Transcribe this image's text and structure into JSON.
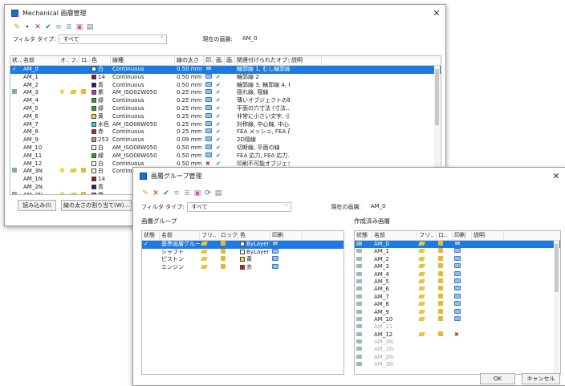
{
  "win1": {
    "title": "Mechanical 画層管理",
    "filter_label": "フィルタ タイプ:",
    "filter_value": "すべて",
    "current_label": "現在の画層:",
    "current_value": "AM_0",
    "columns": [
      "状..",
      "名前",
      "オ..",
      "フ..",
      "ロ..",
      "色",
      "線種",
      "線の太さ",
      "印..",
      "画..",
      "画..",
      "関連付けられたオブジ...",
      "説明"
    ],
    "rows": [
      {
        "st": "✓",
        "name": "AM_0",
        "on": "",
        "fr": "",
        "lk": "",
        "ccol": "#ffffff",
        "cname": "白",
        "lt": "Continuous",
        "lw": "0.50 mm",
        "pl": "1",
        "a": "1",
        "b": "1",
        "rel": "輪郭線 1, むし輪郭線",
        "sel": true
      },
      {
        "st": "",
        "name": "AM_1",
        "on": "",
        "fr": "",
        "lk": "",
        "ccol": "#8b1a1a",
        "cname": "14",
        "lt": "Continuous",
        "lw": "0.50 mm",
        "pl": "1",
        "a": "1",
        "b": "",
        "rel": "輪郭線 2"
      },
      {
        "st": "",
        "name": "AM_2",
        "on": "",
        "fr": "",
        "lk": "",
        "ccol": "#1a1a8b",
        "cname": "青",
        "lt": "Continuous",
        "lw": "0.50 mm",
        "pl": "1",
        "a": "1",
        "b": "",
        "rel": "輪郭線 3, 輪郭線 4, F..."
      },
      {
        "st": "l",
        "name": "AM_3",
        "on": "b",
        "fr": "s",
        "lk": "l",
        "ccol": "#c02cc0",
        "cname": "紫",
        "lt": "AM_ISO02W050",
        "lw": "0.25 mm",
        "pl": "1",
        "a": "1",
        "b": "",
        "rel": "隠れ線, 隠線"
      },
      {
        "st": "",
        "name": "AM_4",
        "on": "",
        "fr": "",
        "lk": "",
        "ccol": "#22aa22",
        "cname": "緑",
        "lt": "Continuous",
        "lw": "0.25 mm",
        "pl": "1",
        "a": "1",
        "b": "",
        "rel": "薄いオブジェクトの断..."
      },
      {
        "st": "",
        "name": "AM_5",
        "on": "",
        "fr": "",
        "lk": "",
        "ccol": "#22aa22",
        "cname": "緑",
        "lt": "Continuous",
        "lw": "0.25 mm",
        "pl": "1",
        "a": "1",
        "b": "",
        "rel": "平面の穴寸法 (寸法..."
      },
      {
        "st": "",
        "name": "AM_6",
        "on": "",
        "fr": "",
        "lk": "",
        "ccol": "#f0e020",
        "cname": "黄",
        "lt": "Continuous",
        "lw": "0.25 mm",
        "pl": "1",
        "a": "1",
        "b": "",
        "rel": "非常に小さい文字, 小..."
      },
      {
        "st": "",
        "name": "AM_7",
        "on": "",
        "fr": "",
        "lk": "",
        "ccol": "#20d0d0",
        "cname": "水色",
        "lt": "AM_ISO08W050",
        "lw": "0.25 mm",
        "pl": "1",
        "a": "1",
        "b": "",
        "rel": "対称線, 中心線, 中心..."
      },
      {
        "st": "",
        "name": "AM_8",
        "on": "",
        "fr": "",
        "lk": "",
        "ccol": "#dd1818",
        "cname": "赤",
        "lt": "Continuous",
        "lw": "0.25 mm",
        "pl": "1",
        "a": "1",
        "b": "",
        "rel": "FEA メッシュ, FEA 荷..."
      },
      {
        "st": "",
        "name": "AM_9",
        "on": "",
        "fr": "",
        "lk": "",
        "ccol": "#9b9b9b",
        "cname": "253",
        "lt": "Continuous",
        "lw": "0.09 mm",
        "pl": "1",
        "a": "1",
        "b": "",
        "rel": "2D隠線"
      },
      {
        "st": "",
        "name": "AM_10",
        "on": "",
        "fr": "",
        "lk": "",
        "ccol": "#ffffff",
        "cname": "白",
        "lt": "AM_ISO08W050",
        "lw": "0.50 mm",
        "pl": "1",
        "a": "1",
        "b": "",
        "rel": "切断線, 平面の線"
      },
      {
        "st": "",
        "name": "AM_11",
        "on": "",
        "fr": "",
        "lk": "",
        "ccol": "#22aa22",
        "cname": "緑",
        "lt": "AM_ISO08W050",
        "lw": "0.50 mm",
        "pl": "1",
        "a": "1",
        "b": "",
        "rel": "FEA 応力, FEA 応力..."
      },
      {
        "st": "",
        "name": "AM_12",
        "on": "",
        "fr": "",
        "lk": "",
        "ccol": "#ffffff",
        "cname": "白",
        "lt": "Continuous",
        "lw": "0.50 mm",
        "pl": "x",
        "a": "1",
        "b": "",
        "rel": "印刷不可能オブジェクト"
      },
      {
        "st": "l",
        "name": "AM_3N",
        "on": "b",
        "fr": "s",
        "lk": "l",
        "ccol": "#ffffff",
        "cname": "白",
        "lt": "Continuous",
        "lw": "0.50 mm",
        "pl": "1",
        "a": "1",
        "b": "",
        "rel": "標準部品, 輪郭線 1"
      },
      {
        "st": "",
        "name": "AM_1N",
        "on": "",
        "fr": "",
        "lk": "",
        "ccol": "#8b1a1a",
        "cname": "14",
        "lt": "",
        "lw": "",
        "pl": "",
        "a": "",
        "b": "",
        "rel": ""
      },
      {
        "st": "",
        "name": "AM_2N",
        "on": "",
        "fr": "",
        "lk": "",
        "ccol": "#1a1a8b",
        "cname": "青",
        "lt": "",
        "lw": "",
        "pl": "",
        "a": "",
        "b": "",
        "rel": ""
      },
      {
        "st": "l",
        "name": "AM_3N",
        "on": "b",
        "fr": "s",
        "lk": "l",
        "ccol": "#c02cc0",
        "cname": "紫",
        "lt": "",
        "lw": "",
        "pl": "",
        "a": "",
        "b": "",
        "rel": ""
      }
    ],
    "btn_load": "読み込み(I)",
    "btn_assign": "線の太さの割り当て(W)..."
  },
  "win2": {
    "title": "画層グループ管理",
    "filter_label": "フィルタ タイプ:",
    "filter_value": "すべて",
    "current_label": "現在の画層:",
    "current_value": "AM_0",
    "left_section": "画層グループ",
    "right_section": "作成済み画層",
    "lcols": [
      "状態",
      "名前",
      "フリ..",
      "ロック",
      "色",
      "印刷"
    ],
    "lrows": [
      {
        "name": "基準画層グループ",
        "ccol": "#ffffff",
        "cname": "ByLayer",
        "sel": true,
        "st": "✓"
      },
      {
        "name": "シャフト",
        "ccol": "#ffffff",
        "cname": "ByLayer",
        "st": ""
      },
      {
        "name": "ピストン",
        "ccol": "#f0e020",
        "cname": "黄",
        "st": ""
      },
      {
        "name": "エンジン",
        "ccol": "#dd1818",
        "cname": "赤",
        "st": ""
      }
    ],
    "rcols": [
      "状態",
      "名前",
      "フリ..",
      "ロ..",
      "印刷",
      "説明"
    ],
    "rrows": [
      {
        "name": "AM_0",
        "sel": true,
        "pl": "1"
      },
      {
        "name": "AM_1",
        "pl": "1"
      },
      {
        "name": "AM_2",
        "pl": "1"
      },
      {
        "name": "AM_3",
        "pl": "1"
      },
      {
        "name": "AM_4",
        "pl": "1"
      },
      {
        "name": "AM_5",
        "pl": "1"
      },
      {
        "name": "AM_6",
        "pl": "1"
      },
      {
        "name": "AM_7",
        "pl": "1"
      },
      {
        "name": "AM_8",
        "pl": "1"
      },
      {
        "name": "AM_9",
        "pl": "1"
      },
      {
        "name": "AM_10",
        "pl": "1"
      },
      {
        "name": "AM_11",
        "gray": true,
        "pl": ""
      },
      {
        "name": "AM_12",
        "pl": "x"
      },
      {
        "name": "AM_3N",
        "gray": true,
        "pl": ""
      },
      {
        "name": "AM_1N",
        "gray": true,
        "pl": ""
      },
      {
        "name": "AM_2N",
        "gray": true,
        "pl": ""
      },
      {
        "name": "AM_3N",
        "gray": true,
        "pl": ""
      }
    ],
    "ok": "OK",
    "cancel": "キャンセル"
  }
}
